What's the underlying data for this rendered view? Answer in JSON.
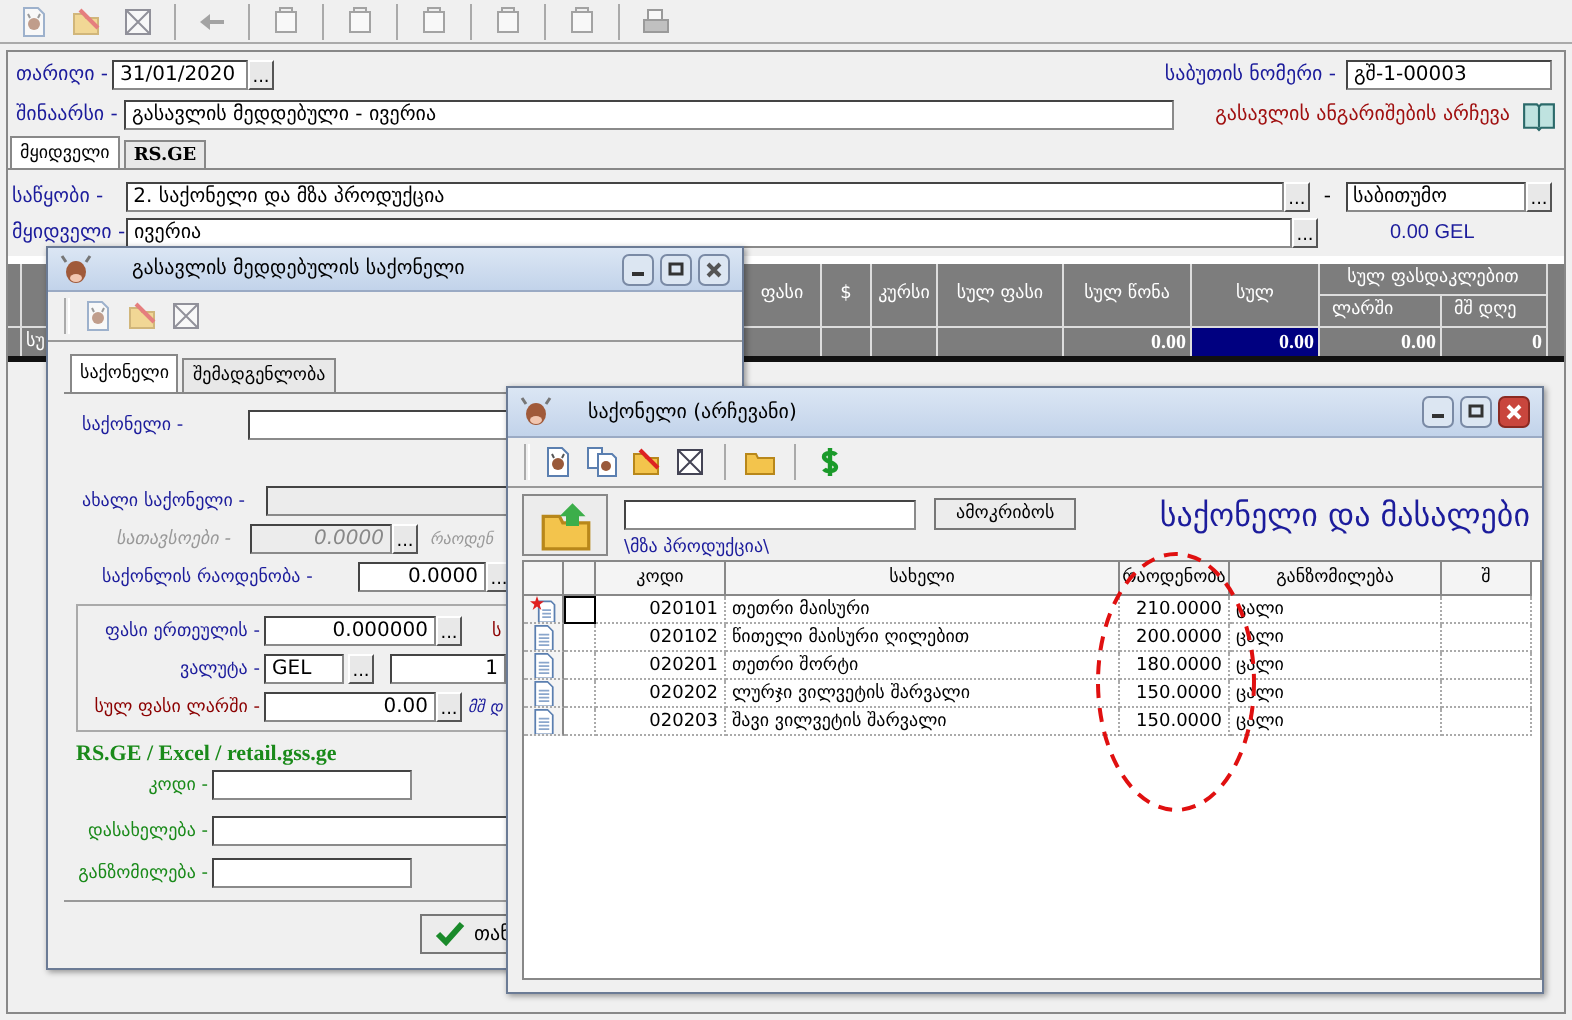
{
  "header": {
    "date_label": "თარიღი -",
    "date": "31/01/2020",
    "date_button": "...",
    "doc_number_label": "საბუთის ნომერი -",
    "doc_number": "გშ-1-00003",
    "content_label": "შინაარსი -",
    "content": "გასავლის მედდებული - ივერია",
    "accounts_link": "გასავლის ანგარიშების არჩევა"
  },
  "tabs": [
    {
      "label": "მყიდველი",
      "selected": true
    },
    {
      "label": "RS.GE",
      "selected": false
    }
  ],
  "warehouse": {
    "label": "საწყობი -",
    "value": "2. საქონელი და მზა პროდუქცია",
    "button": "...",
    "separator": "-",
    "price_type": "საბითუმო",
    "price_button": "..."
  },
  "buyer": {
    "label": "მყიდველი -",
    "value": "ივერია",
    "button": "...",
    "balance": "0.00 GEL"
  },
  "grid": {
    "columns": [
      "ფასი",
      "$",
      "კურსი",
      "სულ ფასი",
      "სულ წონა",
      "სულ"
    ],
    "group": "სულ ფასდაკლებით",
    "subcolumns": [
      "ლარში",
      "მშ დღე"
    ],
    "row": [
      {
        "text": "სუ",
        "selected": false
      },
      {
        "selected": false
      },
      {
        "selected": false
      },
      {
        "selected": false
      },
      {
        "selected": false
      },
      {
        "text": "0.00",
        "selected": false
      },
      {
        "text": "0.00",
        "selected": true
      },
      {
        "text": "0.00",
        "selected": false
      },
      {
        "text": "0",
        "selected": false
      }
    ]
  },
  "goods_dialog": {
    "title": "გასავლის მედდებულის საქონელი",
    "tabs": [
      {
        "label": "საქონელი",
        "selected": true
      },
      {
        "label": "შემადგენლობა",
        "selected": false
      }
    ],
    "goods_label": "საქონელი -",
    "new_goods_label": "ახალი საქონელი -",
    "container_label": "სათავსოები -",
    "container_value": "0.0000",
    "container_button": "...",
    "quantity_cut": "რაოდენ",
    "quantity_label": "საქონლის რაოდენობა -",
    "quantity": "0.0000",
    "quantity_button": "...",
    "unit_price_label": "ფასი ერთეულის -",
    "unit_price": "0.000000",
    "unit_price_button": "...",
    "unit_price_cut": "ს",
    "currency_label": "ვალუტა -",
    "currency": "GEL",
    "currency_button": "...",
    "rate": "1",
    "total_label": "სულ ფასი ლარში -",
    "total": "0.00",
    "total_button": "...",
    "vat_cut": "მშ დ",
    "rs_title": "RS.GE / Excel / retail.gss.ge",
    "code_label": "კოდი -",
    "name_label": "დასახელება -",
    "unit_label": "განზომილება -",
    "ok_button": "თან"
  },
  "selection_dialog": {
    "title": "საქონელი (არჩევანი)",
    "search_button": "ამოკრიბოს",
    "path": "\\მზა პროდუქცია\\",
    "heading": "საქონელი და მასალები",
    "columns": [
      "კოდი",
      "სახელი",
      "რაოდენობა",
      "განზომილება",
      "შ"
    ],
    "rows": [
      {
        "code": "020101",
        "name": "თეთრი მაისური",
        "quantity": "210.0000",
        "unit": "ცალი",
        "is_new": true,
        "selected": true
      },
      {
        "code": "020102",
        "name": "წითელი მაისური ღილებით",
        "quantity": "200.0000",
        "unit": "ცალი",
        "is_new": false,
        "selected": false
      },
      {
        "code": "020201",
        "name": "თეთრი შორტი",
        "quantity": "180.0000",
        "unit": "ცალი",
        "is_new": false,
        "selected": false
      },
      {
        "code": "020202",
        "name": "ლურჯი ვილვეტის შარვალი",
        "quantity": "150.0000",
        "unit": "ცალი",
        "is_new": false,
        "selected": false
      },
      {
        "code": "020203",
        "name": "შავი ვილვეტის შარვალი",
        "quantity": "150.0000",
        "unit": "ცალი",
        "is_new": false,
        "selected": false
      }
    ]
  }
}
